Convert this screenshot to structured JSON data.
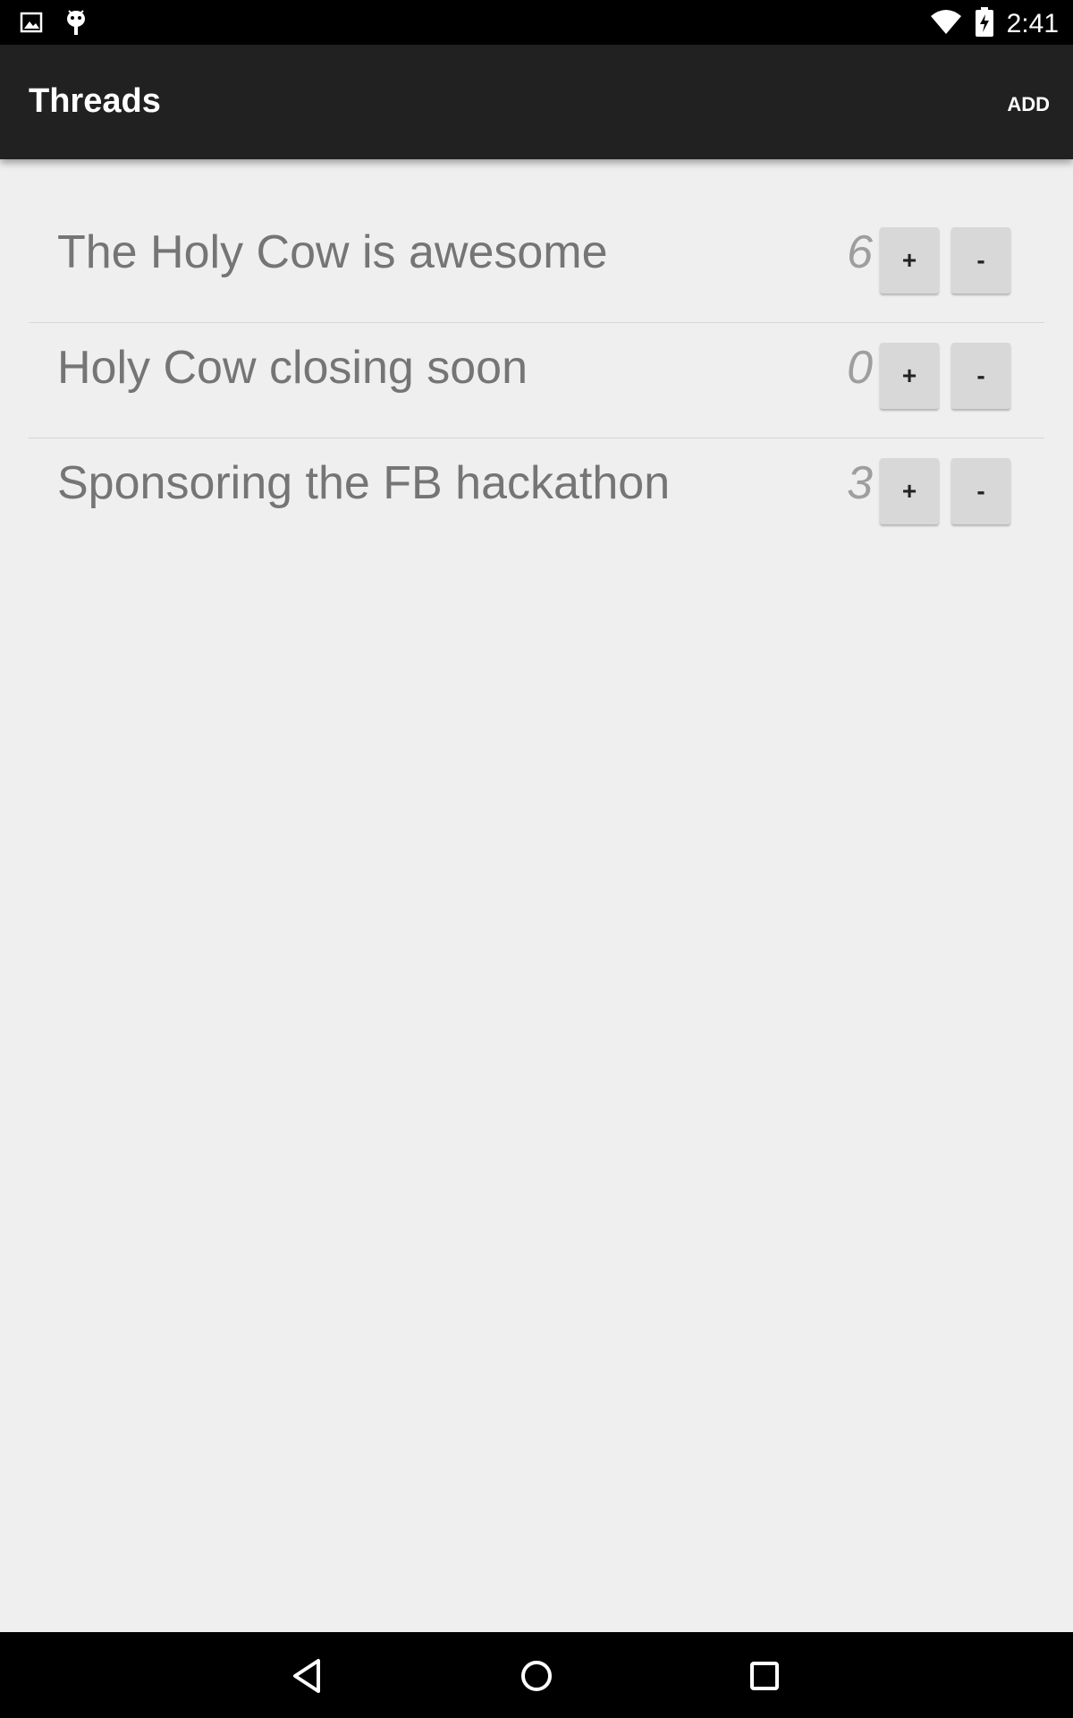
{
  "status_bar": {
    "time": "2:41",
    "icons": [
      "image-icon",
      "android-icon",
      "wifi-icon",
      "battery-charging-icon"
    ]
  },
  "app_bar": {
    "title": "Threads",
    "add_label": "ADD"
  },
  "threads": [
    {
      "title": "The Holy Cow is awesome",
      "count": "6",
      "plus": "+",
      "minus": "-"
    },
    {
      "title": "Holy Cow closing soon",
      "count": "0",
      "plus": "+",
      "minus": "-"
    },
    {
      "title": "Sponsoring the FB hackathon",
      "count": "3",
      "plus": "+",
      "minus": "-"
    }
  ],
  "nav_bar": {
    "icons": [
      "back-icon",
      "home-icon",
      "recent-apps-icon"
    ]
  },
  "colors": {
    "app_bar": "#212121",
    "background": "#efefef",
    "status_bar": "#000000"
  }
}
